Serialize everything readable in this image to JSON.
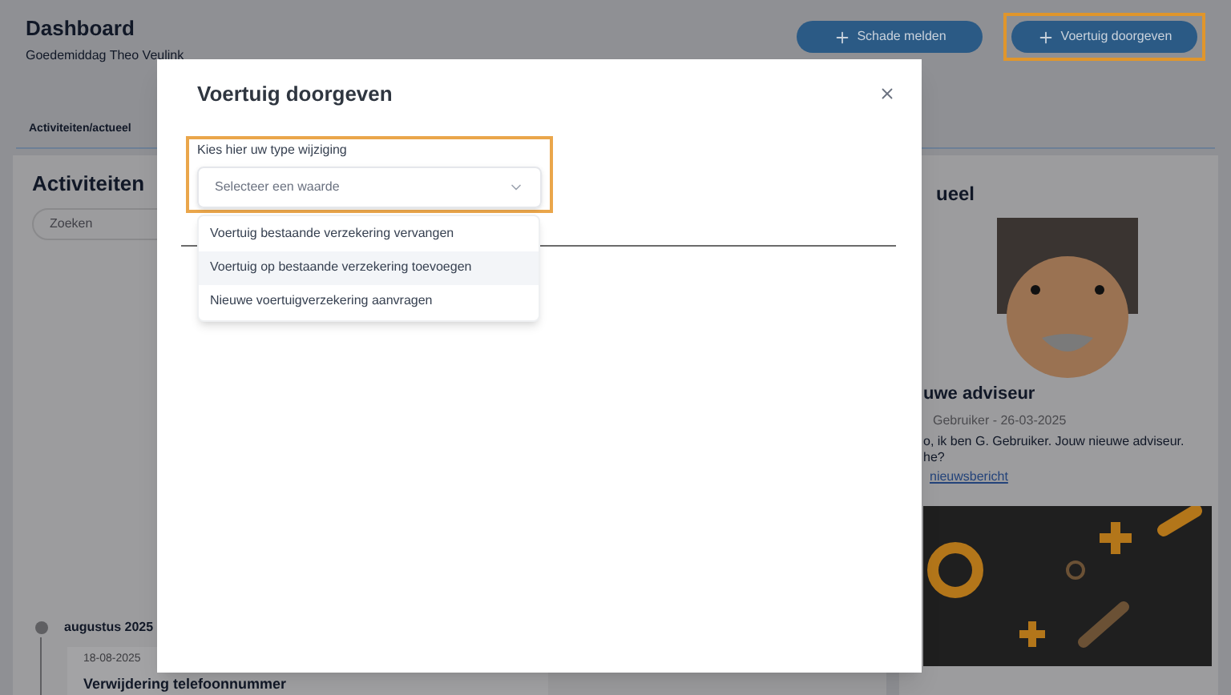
{
  "header": {
    "title": "Dashboard",
    "greeting": "Goedemiddag Theo Veulink"
  },
  "actions": [
    {
      "label": "Schade melden",
      "highlighted": false
    },
    {
      "label": "Voertuig doorgeven",
      "highlighted": true
    }
  ],
  "tabs": [
    {
      "label": "Activiteiten/actueel",
      "selected": true
    }
  ],
  "activities": {
    "title": "Activiteiten",
    "search": {
      "placeholder": "Zoeken"
    },
    "month": "augustus 2025",
    "entry": {
      "date": "18-08-2025",
      "title": "Verwijdering telefoonnummer"
    }
  },
  "news": {
    "title": "ueel",
    "heading": "uwe adviseur",
    "meta": "Gebruiker - 26-03-2025",
    "text_line_1": "o, ik ben G. Gebruiker. Jouw nieuwe adviseur.",
    "text_line_2": "he?",
    "link": "nieuwsbericht"
  },
  "modal": {
    "title": "Voertuig doorgeven",
    "field": {
      "label": "Kies hier uw type wijziging",
      "placeholder": "Selecteer een waarde",
      "highlighted": true
    },
    "options": [
      {
        "label": "Voertuig bestaande verzekering vervangen",
        "highlighted": false
      },
      {
        "label": "Voertuig op bestaande verzekering toevoegen",
        "highlighted": true
      },
      {
        "label": "Nieuwe voertuigverzekering aanvragen",
        "highlighted": false
      }
    ]
  }
}
